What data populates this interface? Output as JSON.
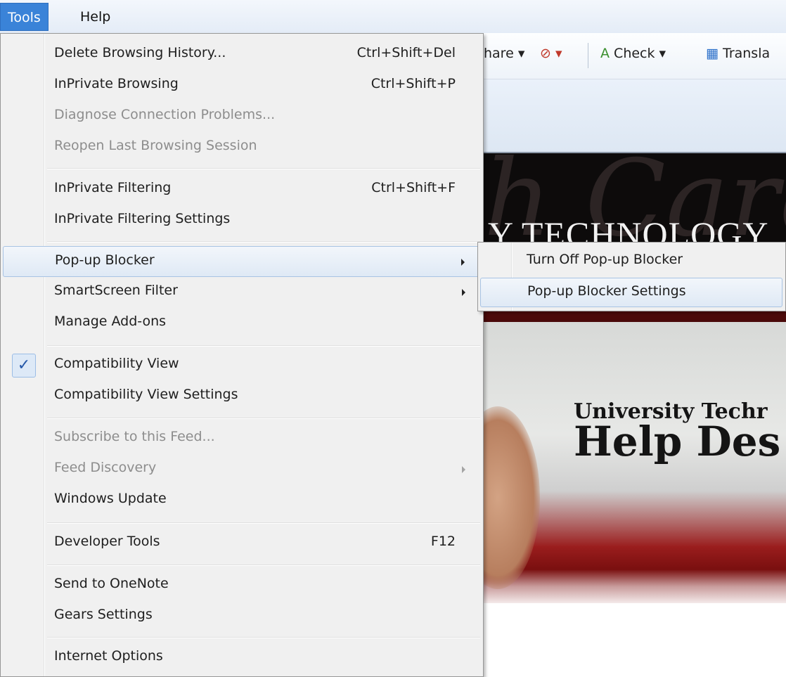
{
  "menubar": {
    "tools": "Tools",
    "help": "Help"
  },
  "browser": {
    "toolbar": {
      "share": "hare",
      "check": "Check",
      "translate": "Transla"
    },
    "site_script": "h Care",
    "site_header_title": "Y TECHNOLOGY",
    "banner_line1": "University Techr",
    "banner_line2": "Help Des"
  },
  "tools_menu": {
    "items": [
      {
        "label": "Delete Browsing History...",
        "shortcut": "Ctrl+Shift+Del"
      },
      {
        "label": "InPrivate Browsing",
        "shortcut": "Ctrl+Shift+P"
      },
      {
        "label": "Diagnose Connection Problems...",
        "shortcut": ""
      },
      {
        "label": "Reopen Last Browsing Session",
        "shortcut": ""
      },
      {
        "label": "InPrivate Filtering",
        "shortcut": "Ctrl+Shift+F"
      },
      {
        "label": "InPrivate Filtering Settings",
        "shortcut": ""
      },
      {
        "label": "Pop-up Blocker",
        "shortcut": ""
      },
      {
        "label": "SmartScreen Filter",
        "shortcut": ""
      },
      {
        "label": "Manage Add-ons",
        "shortcut": ""
      },
      {
        "label": "Compatibility View",
        "shortcut": "",
        "checked": true
      },
      {
        "label": "Compatibility View Settings",
        "shortcut": ""
      },
      {
        "label": "Subscribe to this Feed...",
        "shortcut": ""
      },
      {
        "label": "Feed Discovery",
        "shortcut": ""
      },
      {
        "label": "Windows Update",
        "shortcut": ""
      },
      {
        "label": "Developer Tools",
        "shortcut": "F12"
      },
      {
        "label": "Send to OneNote",
        "shortcut": ""
      },
      {
        "label": "Gears Settings",
        "shortcut": ""
      },
      {
        "label": "Internet Options",
        "shortcut": ""
      }
    ],
    "check_glyph": "✓"
  },
  "popup_submenu": {
    "items": [
      {
        "label": "Turn Off Pop-up Blocker"
      },
      {
        "label": "Pop-up Blocker Settings"
      }
    ]
  }
}
